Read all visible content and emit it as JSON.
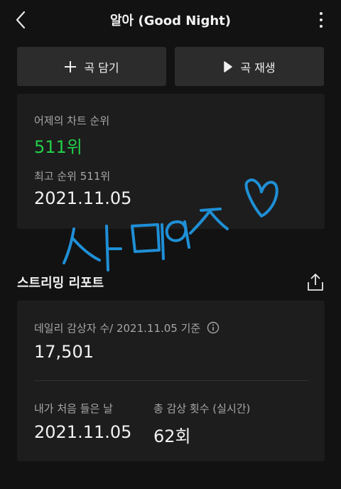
{
  "header": {
    "title": "알아 (Good Night)",
    "back_icon": "chevron-left-icon",
    "more_icon": "more-vertical-icon"
  },
  "actions": {
    "add_label": "곡 담기",
    "add_icon": "plus-icon",
    "play_label": "곡 재생",
    "play_icon": "play-icon"
  },
  "chart": {
    "yesterday_rank_label": "어제의 차트 순위",
    "yesterday_rank_value": "511위",
    "best_rank_label": "최고 순위 511위",
    "best_rank_date": "2021.11.05"
  },
  "streaming_report": {
    "title": "스트리밍 리포트",
    "share_icon": "share-icon",
    "daily_listeners_label": "데일리 감상자 수/ 2021.11.05 기준",
    "daily_listeners_value": "17,501",
    "info_icon": "info-icon",
    "first_listen_label": "내가 처음 들은 날",
    "first_listen_value": "2021.11.05",
    "total_plays_label": "총 감상 횟수 (실시간)",
    "total_plays_value": "62회"
  },
  "colors": {
    "background": "#121212",
    "card": "#1d1d1d",
    "button": "#2c2c2c",
    "accent_green": "#22d04a",
    "handwriting_blue": "#1f8fd6"
  },
  "handwriting": {
    "text": "사랑해",
    "icon": "heart-icon"
  }
}
